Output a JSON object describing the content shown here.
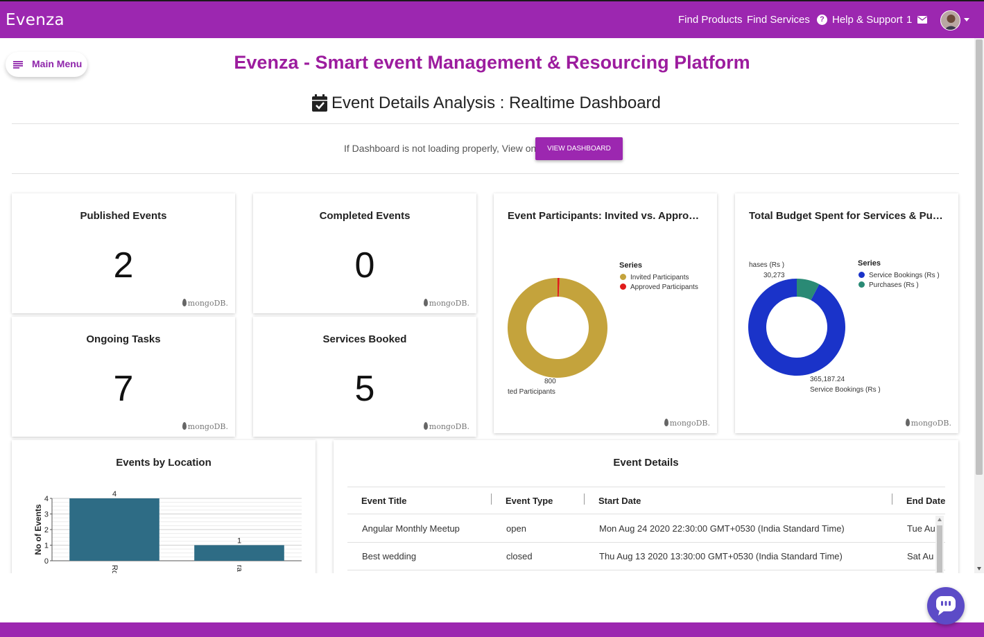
{
  "header": {
    "brand": "Evenza",
    "links": [
      "Find Products",
      "Find Services",
      "Help & Support"
    ],
    "mail_count": "1",
    "accent_color": "#9c27b0"
  },
  "menu": {
    "label": "Main Menu"
  },
  "page": {
    "title": "Evenza - Smart event Management & Resourcing Platform",
    "subtitle": "Event Details Analysis : Realtime Dashboard",
    "notice": "If Dashboard is not loading properly, View on",
    "view_button": "VIEW DASHBOARD"
  },
  "stats": [
    {
      "title": "Published Events",
      "value": "2"
    },
    {
      "title": "Completed Events",
      "value": "0"
    },
    {
      "title": "Ongoing Tasks",
      "value": "7"
    },
    {
      "title": "Services Booked",
      "value": "5"
    }
  ],
  "watermark": "mongoDB.",
  "participants_card": {
    "title": "Event Participants: Invited vs. Approved Participants",
    "legend_title": "Series",
    "legend": [
      "Invited Participants",
      "Approved Participants"
    ],
    "value_label": "800",
    "slice_label": "ted Participants"
  },
  "budget_card": {
    "title": "Total Budget Spent for Services & Purchases",
    "legend_title": "Series",
    "legend": [
      "Service Bookings (Rs )",
      "Purchases (Rs )"
    ],
    "small_label": "hases (Rs )",
    "small_value": "30,273",
    "big_value": "365,187.24",
    "big_label": "Service Bookings (Rs )"
  },
  "location_card": {
    "title": "Events by Location",
    "ylabel": "No of Events",
    "xtick_labels": [
      "Rd",
      "ra"
    ]
  },
  "table": {
    "title": "Event Details",
    "headers": [
      "Event Title",
      "Event Type",
      "Start Date",
      "End Date"
    ],
    "rows": [
      [
        "Angular Monthly Meetup",
        "open",
        "Mon Aug 24 2020 22:30:00 GMT+0530 (India Standard Time)",
        "Tue Au"
      ],
      [
        "Best wedding",
        "closed",
        "Thu Aug 13 2020 13:30:00 GMT+0530 (India Standard Time)",
        "Sat Au"
      ]
    ]
  },
  "chart_data": [
    {
      "type": "pie",
      "title": "Event Participants: Invited vs. Approved Participants",
      "categories": [
        "Invited Participants",
        "Approved Participants"
      ],
      "values": [
        800,
        5
      ],
      "colors": [
        "#c4a33c",
        "#e01b1b"
      ],
      "legend": "top-right"
    },
    {
      "type": "pie",
      "title": "Total Budget Spent for Services & Purchases",
      "categories": [
        "Service Bookings (Rs )",
        "Purchases (Rs )"
      ],
      "values": [
        365187.24,
        30273
      ],
      "colors": [
        "#1a33c9",
        "#2a8a75"
      ],
      "legend": "top-right"
    },
    {
      "type": "bar",
      "title": "Events by Location",
      "categories": [
        "Rd",
        "ra"
      ],
      "values": [
        4,
        1
      ],
      "ylabel": "No of Events",
      "ylim": [
        0,
        4
      ],
      "yticks": [
        0,
        1,
        2,
        3,
        4
      ],
      "color": "#2e6c85",
      "grid": true
    }
  ]
}
